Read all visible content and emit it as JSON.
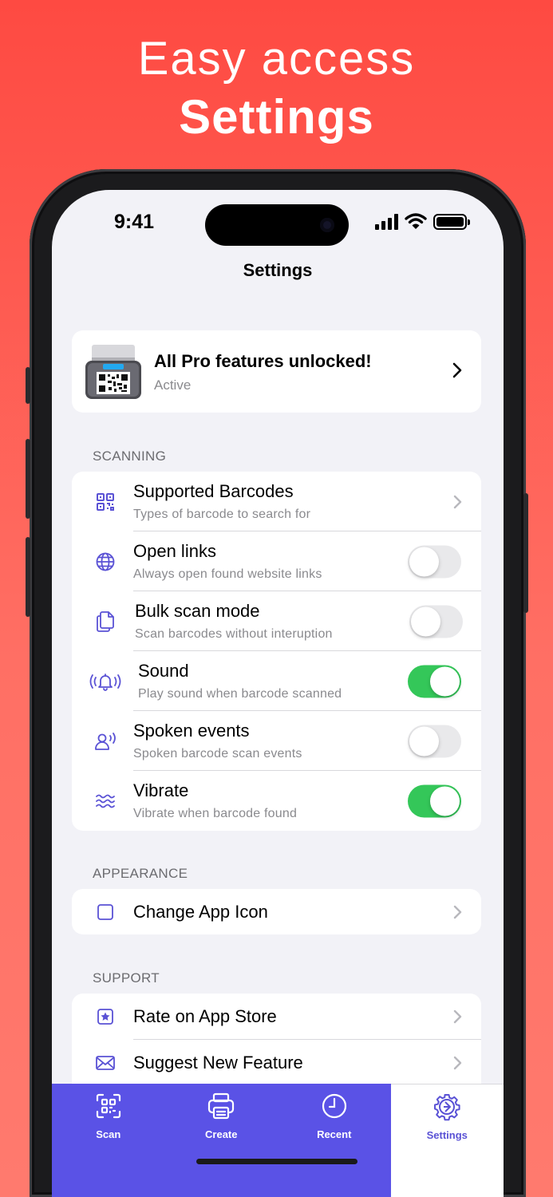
{
  "headline": {
    "line1": "Easy access",
    "line2": "Settings"
  },
  "status_bar": {
    "time": "9:41"
  },
  "nav": {
    "title": "Settings"
  },
  "pro_banner": {
    "title": "All Pro features unlocked!",
    "subtitle": "Active",
    "icon": "barcode-scanner-icon"
  },
  "sections": {
    "scanning": {
      "header": "SCANNING",
      "rows": [
        {
          "label": "Supported Barcodes",
          "subtitle": "Types of barcode to search for",
          "icon": "qrcode-icon",
          "control": "chevron"
        },
        {
          "label": "Open links",
          "subtitle": "Always open found website links",
          "icon": "globe-icon",
          "control": "toggle",
          "on": false
        },
        {
          "label": "Bulk scan mode",
          "subtitle": "Scan barcodes without interuption",
          "icon": "documents-icon",
          "control": "toggle",
          "on": false
        },
        {
          "label": "Sound",
          "subtitle": "Play sound when barcode scanned",
          "icon": "bell-ringing-icon",
          "control": "toggle",
          "on": true
        },
        {
          "label": "Spoken events",
          "subtitle": "Spoken barcode scan events",
          "icon": "person-wave-icon",
          "control": "toggle",
          "on": false
        },
        {
          "label": "Vibrate",
          "subtitle": "Vibrate when barcode found",
          "icon": "waves-icon",
          "control": "toggle",
          "on": true
        }
      ]
    },
    "appearance": {
      "header": "APPEARANCE",
      "rows": [
        {
          "label": "Change App Icon",
          "icon": "app-square-icon",
          "control": "chevron"
        }
      ]
    },
    "support": {
      "header": "SUPPORT",
      "rows": [
        {
          "label": "Rate on App Store",
          "icon": "star-square-icon",
          "control": "chevron"
        },
        {
          "label": "Suggest New Feature",
          "icon": "envelope-icon",
          "control": "chevron"
        }
      ]
    }
  },
  "tabbar": {
    "tabs": [
      {
        "label": "Scan",
        "icon": "scan-icon",
        "active": false
      },
      {
        "label": "Create",
        "icon": "printer-icon",
        "active": false
      },
      {
        "label": "Recent",
        "icon": "clock-icon",
        "active": false
      },
      {
        "label": "Settings",
        "icon": "gear-icon",
        "active": true
      }
    ]
  },
  "colors": {
    "background_top": "#fe4a42",
    "accent": "#5a52d5",
    "tab_bar": "#5a52e6",
    "toggle_on": "#34c759",
    "toggle_off": "#e9e9eb"
  }
}
